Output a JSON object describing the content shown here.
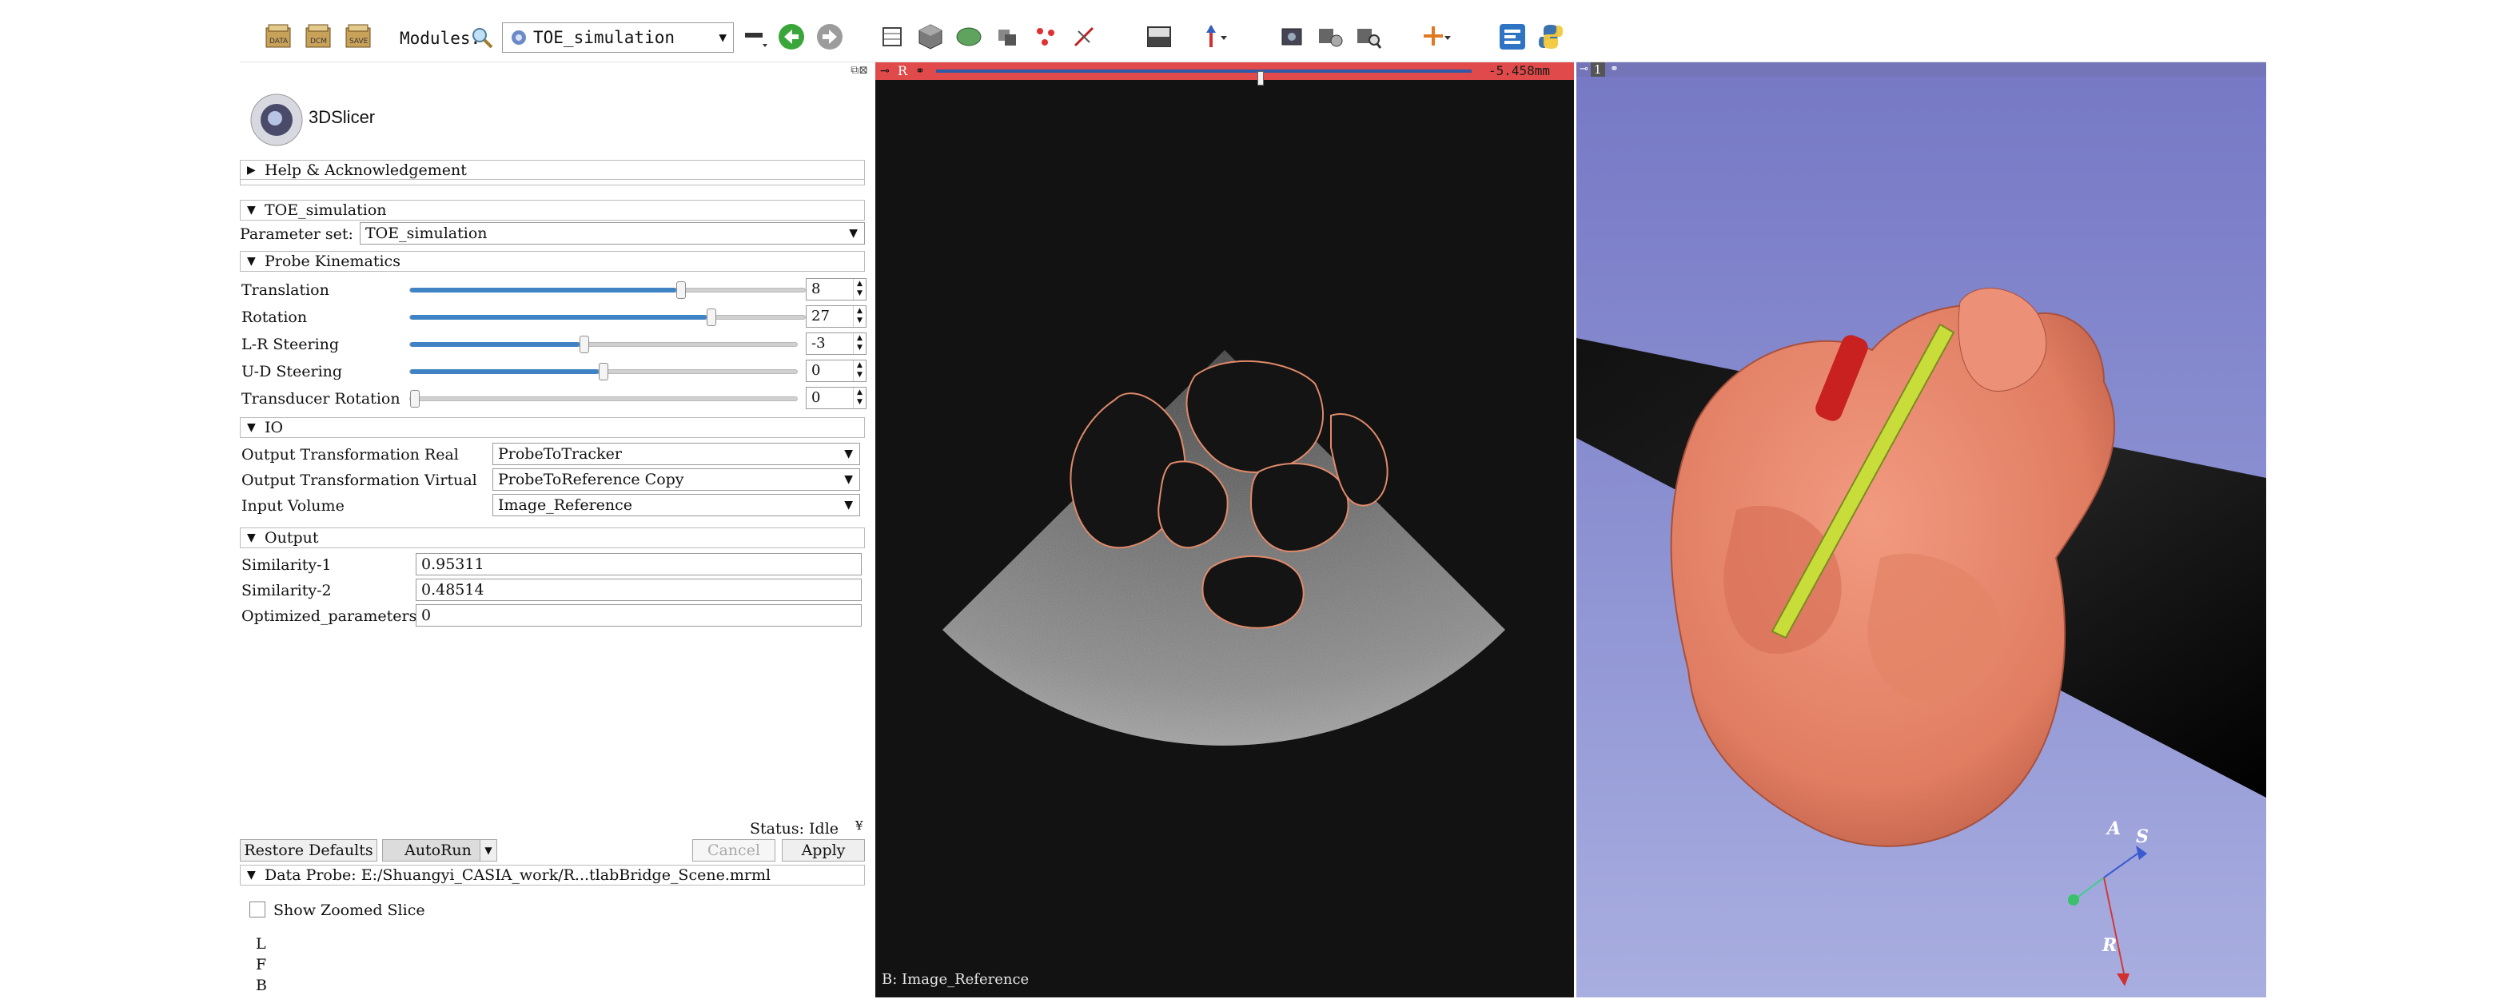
{
  "toolbar": {
    "modules_label": "Modules:",
    "module_selected": "TOE_simulation",
    "buttons": [
      "data-icon",
      "dcm-icon",
      "save-icon",
      "back-icon",
      "forward-icon",
      "layout-icons",
      "python-icon"
    ]
  },
  "panel": {
    "logo_text": "3DSlicer",
    "help_section": "Help & Acknowledgement",
    "module_section": "TOE_simulation",
    "parameter_set_label": "Parameter set:",
    "parameter_set_value": "TOE_simulation",
    "kinematics_section": "Probe Kinematics",
    "sliders": [
      {
        "label": "Translation",
        "value": "8",
        "fraction": 0.69
      },
      {
        "label": "Rotation",
        "value": "27",
        "fraction": 0.77
      },
      {
        "label": "L-R Steering",
        "value": "-3",
        "fraction": 0.45
      },
      {
        "label": "U-D Steering",
        "value": "0",
        "fraction": 0.5
      },
      {
        "label": "Transducer Rotation",
        "value": "0",
        "fraction": 0.0
      }
    ],
    "io_section": "IO",
    "io": [
      {
        "label": "Output Transformation Real",
        "value": "ProbeToTracker"
      },
      {
        "label": "Output Transformation Virtual",
        "value": "ProbeToReference Copy"
      },
      {
        "label": "Input Volume",
        "value": "Image_Reference"
      }
    ],
    "output_section": "Output",
    "outputs": [
      {
        "label": "Similarity-1",
        "value": "0.95311"
      },
      {
        "label": "Similarity-2",
        "value": "0.48514"
      },
      {
        "label": "Optimized_parameters",
        "value": "0"
      }
    ],
    "status": "Status: Idle",
    "restore_defaults": "Restore Defaults",
    "autorun": "AutoRun",
    "cancel": "Cancel",
    "apply": "Apply",
    "data_probe": "Data Probe: E:/Shuangyi_CASIA_work/R...tlabBridge_Scene.mrml",
    "show_zoomed_slice": "Show Zoomed Slice",
    "probe_lines": [
      "L",
      "F",
      "B"
    ]
  },
  "slice_view": {
    "orientation": "R",
    "offset": "-5.458mm",
    "caption": "B: Image_Reference"
  },
  "view3d": {
    "view_number": "1",
    "axes": {
      "a": "A",
      "s": "S",
      "r": "R"
    }
  },
  "colors": {
    "slice_bar": "#e04a4a",
    "heart": "#e8876d",
    "probe": "#c8dc3a",
    "vessel": "#c92020",
    "view_bg": "#8c91d2"
  }
}
